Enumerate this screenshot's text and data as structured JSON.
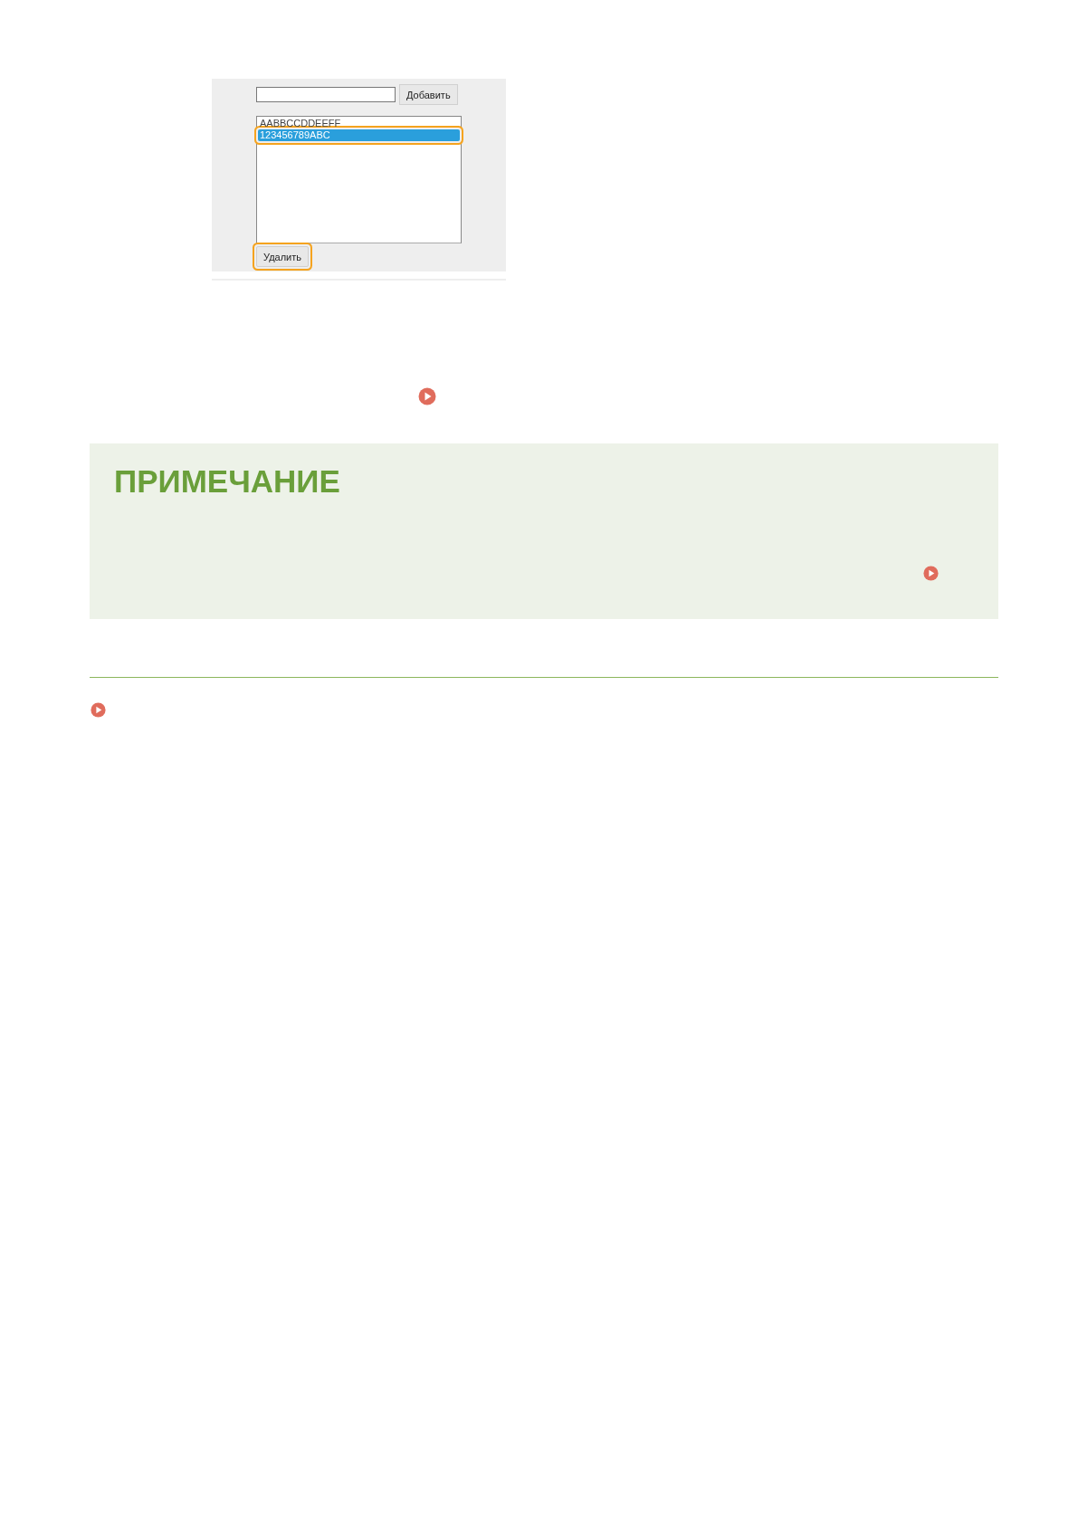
{
  "screenshot": {
    "add_button": "Добавить",
    "list_items": [
      {
        "label": "AABBCCDDEEFF",
        "selected": false
      },
      {
        "label": "123456789ABC",
        "selected": true
      }
    ],
    "delete_button": "Удалить"
  },
  "note": {
    "title": "ПРИМЕЧАНИЕ"
  }
}
